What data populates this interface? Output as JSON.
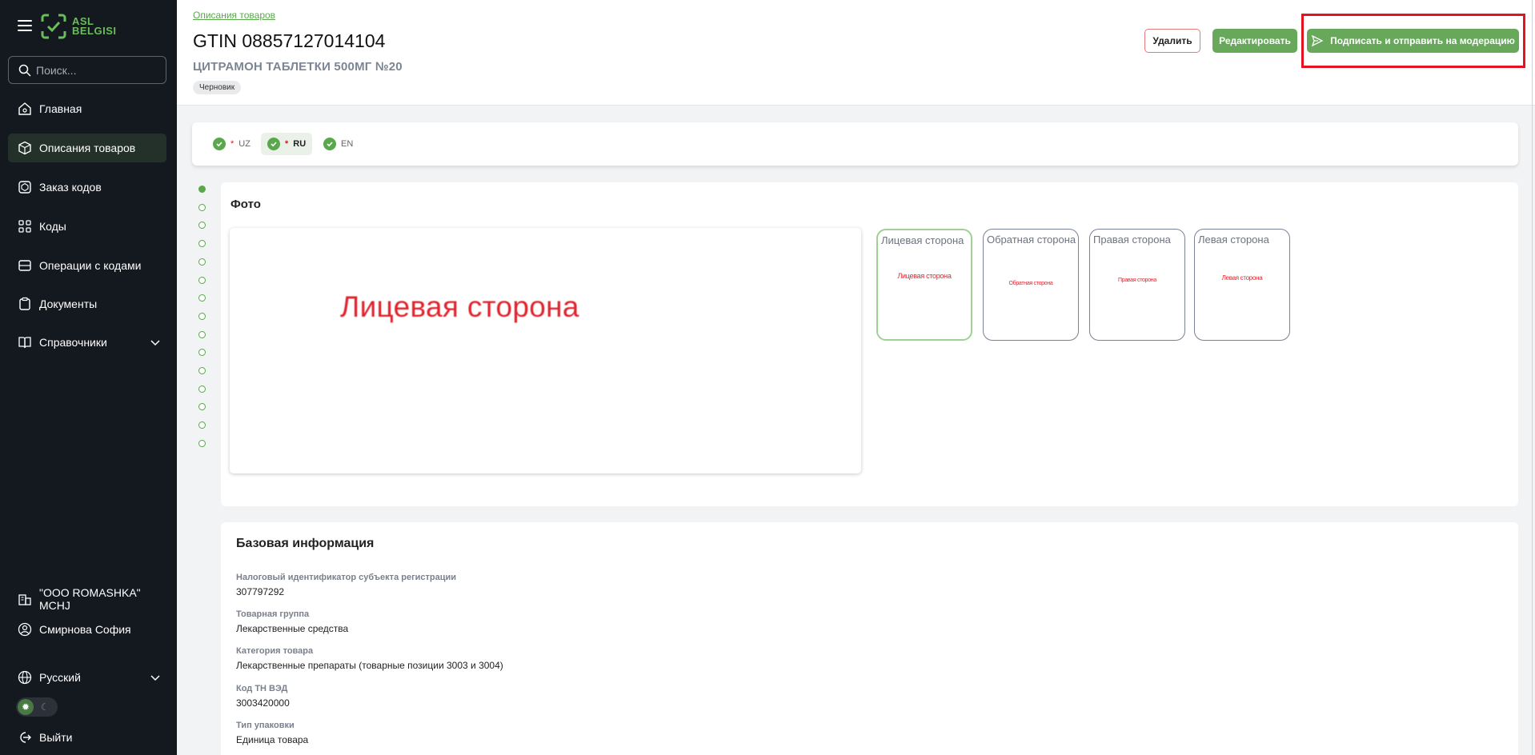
{
  "app": {
    "logo_text_line1": "ASL",
    "logo_text_line2": "BELGISI",
    "accent_color": "#5aa84c"
  },
  "sidebar": {
    "search_placeholder": "Поиск...",
    "items": [
      {
        "label": "Главная",
        "icon": "home-icon"
      },
      {
        "label": "Описания товаров",
        "icon": "box-icon",
        "active": true
      },
      {
        "label": "Заказ кодов",
        "icon": "order-codes-icon"
      },
      {
        "label": "Коды",
        "icon": "codes-icon"
      },
      {
        "label": "Операции с кодами",
        "icon": "operations-icon"
      },
      {
        "label": "Документы",
        "icon": "document-icon"
      },
      {
        "label": "Справочники",
        "icon": "book-icon",
        "expandable": true
      }
    ],
    "company": "\"OOO ROMASHKA\" MCHJ",
    "user": "Смирнова София",
    "language": "Русский",
    "logout": "Выйти"
  },
  "header": {
    "breadcrumb": "Описания товаров",
    "gtin": "GTIN 08857127014104",
    "product_name": "ЦИТРАМОН ТАБЛЕТКИ 500МГ №20",
    "status": "Черновик",
    "delete_label": "Удалить",
    "edit_label": "Редактировать",
    "sign_label": "Подписать и отправить на модерацию"
  },
  "languages": [
    {
      "code": "UZ",
      "required": "*",
      "active": false
    },
    {
      "code": "RU",
      "required": "*",
      "active": true
    },
    {
      "code": "EN",
      "required": "",
      "active": false
    }
  ],
  "steps": {
    "total": 15,
    "current": 1
  },
  "photo": {
    "title": "Фото",
    "main_image_text": "Лицевая сторона",
    "thumbnails": [
      {
        "label": "Лицевая сторона",
        "image_text": "Лицевая сторона",
        "selected": true
      },
      {
        "label": "Обратная сторона",
        "image_text": "Обратная сторона",
        "selected": false
      },
      {
        "label": "Правая сторона",
        "image_text": "Правая сторона",
        "selected": false
      },
      {
        "label": "Левая сторона",
        "image_text": "Левая сторона",
        "selected": false
      }
    ]
  },
  "base_info": {
    "title": "Базовая информация",
    "fields": [
      {
        "label": "Налоговый идентификатор субъекта регистрации",
        "value": "307797292"
      },
      {
        "label": "Товарная группа",
        "value": "Лекарственные средства"
      },
      {
        "label": "Категория товара",
        "value": "Лекарственные препараты (товарные позиции 3003 и 3004)"
      },
      {
        "label": "Код ТН ВЭД",
        "value": "3003420000"
      },
      {
        "label": "Тип упаковки",
        "value": "Единица товара"
      }
    ]
  }
}
